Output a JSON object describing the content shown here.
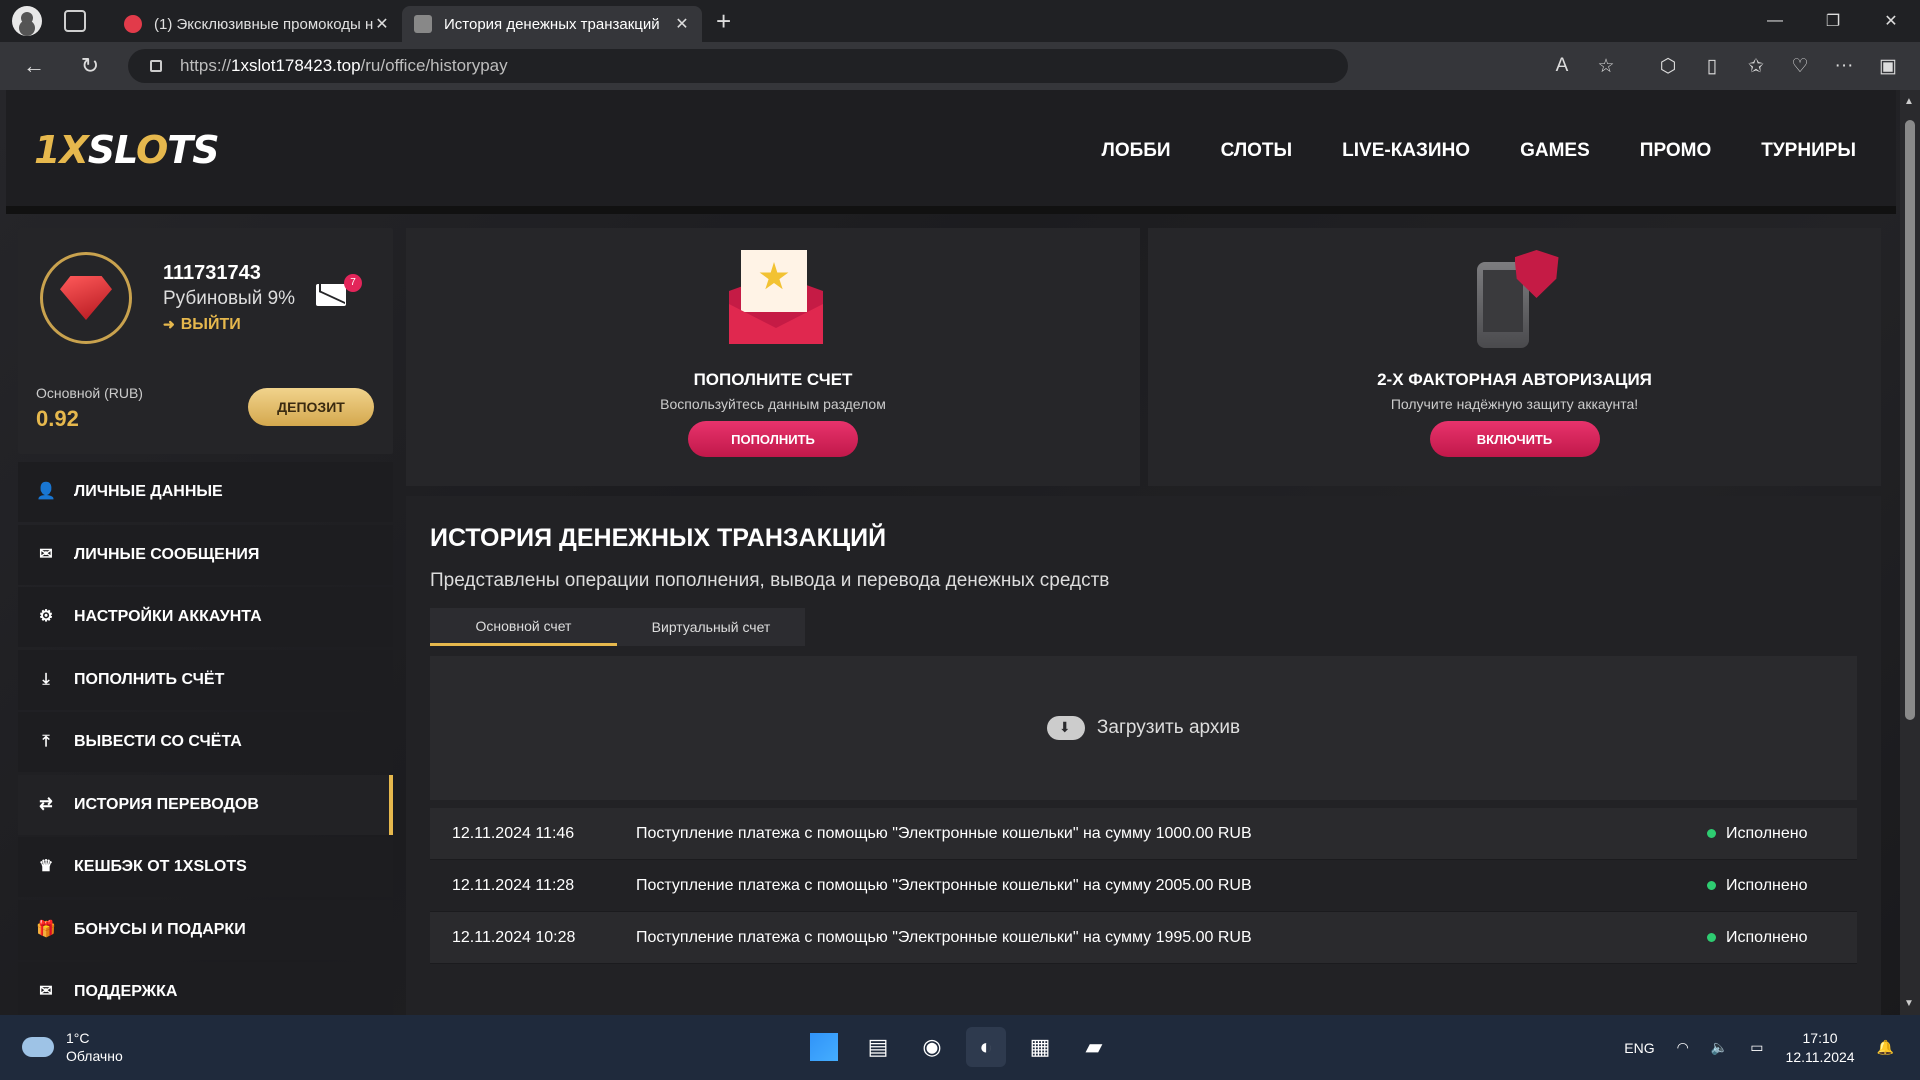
{
  "browser": {
    "tabs": [
      {
        "title": "(1) Эксклюзивные промокоды н"
      },
      {
        "title": "История денежных транзакций"
      }
    ],
    "url_scheme": "https://",
    "url_host": "1xslot178423.top",
    "url_path": "/ru/office/historypay"
  },
  "site": {
    "logo_pre": "1X",
    "logo_mid": "SL",
    "logo_o": "O",
    "logo_post": "TS",
    "nav": [
      "ЛОББИ",
      "СЛОТЫ",
      "LIVE-КАЗИНО",
      "GAMES",
      "ПРОМО",
      "ТУРНИРЫ"
    ]
  },
  "profile": {
    "user_id": "111731743",
    "rank": "Рубиновый 9%",
    "logout": "ВЫЙТИ",
    "mail_count": "7",
    "balance_label": "Основной (RUB)",
    "balance_value": "0.92",
    "deposit_button": "ДЕПОЗИТ"
  },
  "menu": [
    {
      "label": "ЛИЧНЫЕ ДАННЫЕ",
      "icon": "user-icon"
    },
    {
      "label": "ЛИЧНЫЕ СООБЩЕНИЯ",
      "icon": "mail-icon"
    },
    {
      "label": "НАСТРОЙКИ АККАУНТА",
      "icon": "gears-icon"
    },
    {
      "label": "ПОПОЛНИТЬ СЧЁТ",
      "icon": "download-icon"
    },
    {
      "label": "ВЫВЕСТИ СО СЧЁТА",
      "icon": "upload-icon"
    },
    {
      "label": "ИСТОРИЯ ПЕРЕВОДОВ",
      "icon": "transfer-icon",
      "active": true
    },
    {
      "label": "КЕШБЭК ОТ 1XSLOTS",
      "icon": "crown-icon"
    },
    {
      "label": "БОНУСЫ И ПОДАРКИ",
      "icon": "gift-icon"
    },
    {
      "label": "ПОДДЕРЖКА",
      "icon": "mail-icon"
    }
  ],
  "promos": [
    {
      "title": "ПОПОЛНИТЕ СЧЕТ",
      "subtitle": "Воспользуйтесь данным разделом",
      "button": "ПОПОЛНИТЬ"
    },
    {
      "title": "2-Х ФАКТОРНАЯ АВТОРИЗАЦИЯ",
      "subtitle": "Получите надёжную защиту аккаунта!",
      "button": "ВКЛЮЧИТЬ"
    }
  ],
  "history": {
    "title": "ИСТОРИЯ ДЕНЕЖНЫХ ТРАНЗАКЦИЙ",
    "subtitle": "Представлены операции пополнения, вывода и перевода денежных средств",
    "tabs": [
      "Основной счет",
      "Виртуальный счет"
    ],
    "archive": "Загрузить архив",
    "rows": [
      {
        "date": "12.11.2024 11:46",
        "desc": "Поступление платежа с помощью \"Электронные кошельки\" на сумму 1000.00 RUB",
        "status": "Исполнено"
      },
      {
        "date": "12.11.2024 11:28",
        "desc": "Поступление платежа с помощью \"Электронные кошельки\" на сумму 2005.00 RUB",
        "status": "Исполнено"
      },
      {
        "date": "12.11.2024 10:28",
        "desc": "Поступление платежа с помощью \"Электронные кошельки\" на сумму 1995.00 RUB",
        "status": "Исполнено"
      }
    ]
  },
  "taskbar": {
    "temp": "1°C",
    "weather": "Облачно",
    "lang": "ENG",
    "time": "17:10",
    "date": "12.11.2024"
  },
  "colors": {
    "accent": "#e6b84d",
    "primary_button": "#d41f55",
    "success": "#2ecc71"
  }
}
